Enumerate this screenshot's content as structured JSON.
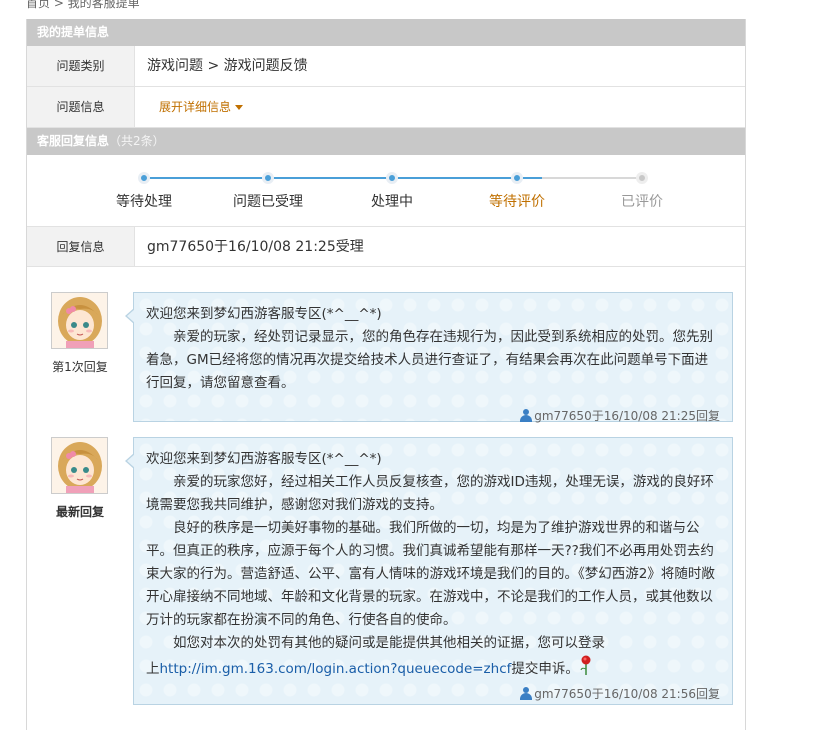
{
  "breadcrumb": "首页 > 我的客服提单",
  "section1": {
    "title": "我的提单信息"
  },
  "category": {
    "label": "问题类别",
    "value": "游戏问题 > 游戏问题反馈"
  },
  "info": {
    "label": "问题信息",
    "expand": "展开详细信息"
  },
  "section2": {
    "title": "客服回复信息",
    "count": "（共2条）"
  },
  "steps": [
    {
      "label": "等待处理",
      "state": "done"
    },
    {
      "label": "问题已受理",
      "state": "done"
    },
    {
      "label": "处理中",
      "state": "done"
    },
    {
      "label": "等待评价",
      "state": "current"
    },
    {
      "label": "已评价",
      "state": "pending"
    }
  ],
  "reply_info": {
    "label": "回复信息",
    "value": "gm77650于16/10/08 21:25受理"
  },
  "replies": [
    {
      "tag": "第1次回复",
      "greeting": "欢迎您来到梦幻西游客服专区(*^__^*)",
      "paragraphs": [
        "亲爱的玩家，经处罚记录显示，您的角色存在违规行为，因此受到系统相应的处罚。您先别着急，GM已经将您的情况再次提交给技术人员进行查证了，有结果会再次在此问题单号下面进行回复，请您留意查看。"
      ],
      "signature": "gm77650于16/10/08 21:25回复"
    },
    {
      "tag": "最新回复",
      "greeting": "欢迎您来到梦幻西游客服专区(*^__^*)",
      "paragraphs": [
        "亲爱的玩家您好，经过相关工作人员反复核查，您的游戏ID违规，处理无误，游戏的良好环境需要您我共同维护，感谢您对我们游戏的支持。",
        "良好的秩序是一切美好事物的基础。我们所做的一切，均是为了维护游戏世界的和谐与公平。但真正的秩序，应源于每个人的习惯。我们真诚希望能有那样一天??我们不必再用处罚去约束大家的行为。营造舒适、公平、富有人情味的游戏环境是我们的目的。《梦幻西游2》将随时敞开心扉接纳不同地域、年龄和文化背景的玩家。在游戏中，不论是我们的工作人员，或其他数以万计的玩家都在扮演不同的角色、行使各自的使命。",
        "如您对本次的处罚有其他的疑问或是能提供其他相关的证据，您可以登录"
      ],
      "link_prefix": "上",
      "link": "http://im.gm.163.com/login.action?queuecode=zhcf",
      "link_suffix": "提交申诉。",
      "signature": "gm77650于16/10/08 21:56回复"
    }
  ],
  "colors": {
    "accent": "#4a9fd8",
    "current_step": "#c07000",
    "header_bg": "#c8c8c8",
    "bubble_bg": "#e6f2f9",
    "link": "#1a5ea8"
  }
}
